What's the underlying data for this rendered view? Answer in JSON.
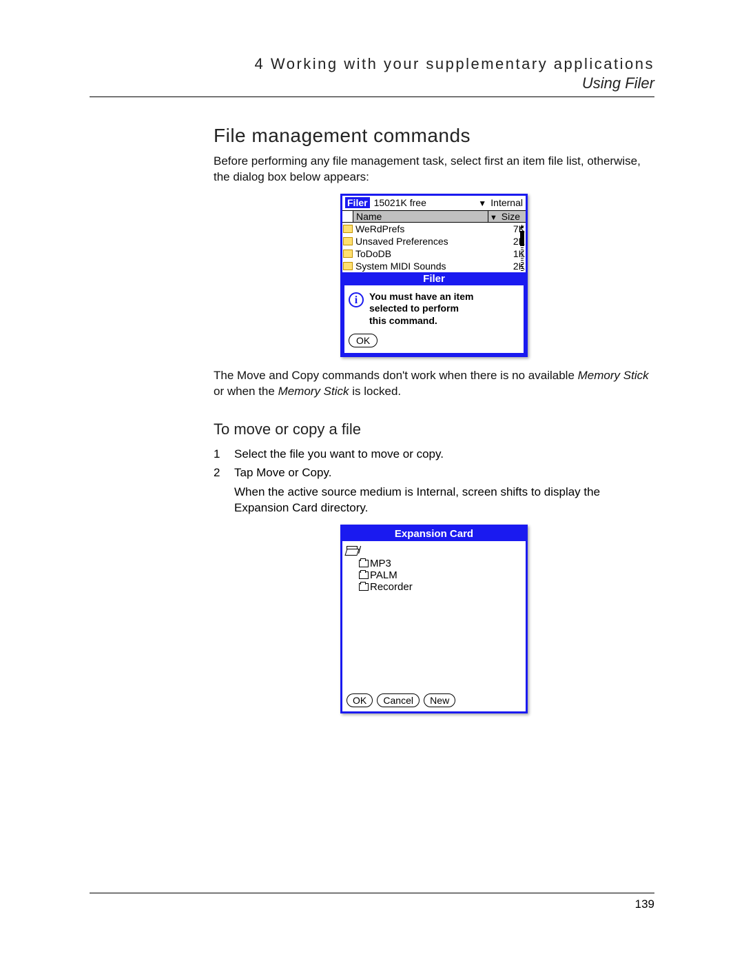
{
  "header": {
    "chapter_num": "4",
    "chapter_title": "Working with your supplementary applications",
    "subtitle": "Using Filer"
  },
  "section": {
    "h1": "File management commands",
    "intro_before": "Before performing any file management task, select first an item file list, otherwise, the dialog box below appears:",
    "note_text_1": "The Move and Copy commands don't work when there is no available ",
    "note_em_1": "Memory Stick",
    "note_text_2": " or when the ",
    "note_em_2": "Memory Stick",
    "note_text_3": " is locked.",
    "h2": "To move or copy a file",
    "steps": [
      {
        "n": "1",
        "t": "Select the file you want to move or copy."
      },
      {
        "n": "2",
        "t": "Tap Move or Copy."
      }
    ],
    "step2_follow": "When the active source medium is Internal, screen shifts to display the Expansion Card directory."
  },
  "filer1": {
    "badge": "Filer",
    "free": "15021K free",
    "location": "Internal",
    "col_name": "Name",
    "col_size": "Size",
    "rows": [
      {
        "name": "WeRdPrefs",
        "size": "7K"
      },
      {
        "name": "Unsaved Preferences",
        "size": "2K"
      },
      {
        "name": "ToDoDB",
        "size": "1K"
      },
      {
        "name": "System MIDI Sounds",
        "size": "2K"
      }
    ],
    "dialog_title": "Filer",
    "dialog_msg_l1": "You must have an item",
    "dialog_msg_l2": "selected to perform",
    "dialog_msg_l3": "this command.",
    "ok": "OK"
  },
  "filer2": {
    "title": "Expansion Card",
    "root": "/",
    "folders": [
      "MP3",
      "PALM",
      "Recorder"
    ],
    "ok": "OK",
    "cancel": "Cancel",
    "new": "New"
  },
  "footer": {
    "page": "139"
  }
}
